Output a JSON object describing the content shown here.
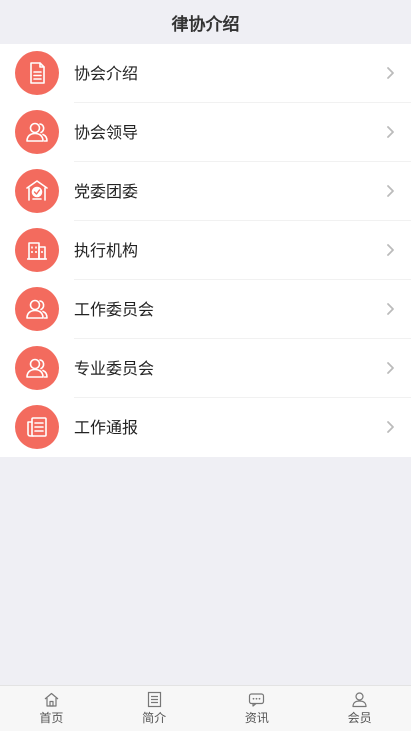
{
  "header": {
    "title": "律协介绍"
  },
  "menu": [
    {
      "label": "协会介绍",
      "icon": "document-icon"
    },
    {
      "label": "协会领导",
      "icon": "users-icon"
    },
    {
      "label": "党委团委",
      "icon": "party-emblem-icon"
    },
    {
      "label": "执行机构",
      "icon": "building-icon"
    },
    {
      "label": "工作委员会",
      "icon": "users-icon"
    },
    {
      "label": "专业委员会",
      "icon": "users-icon"
    },
    {
      "label": "工作通报",
      "icon": "newspaper-icon"
    }
  ],
  "tabbar": [
    {
      "label": "首页",
      "icon": "home-icon"
    },
    {
      "label": "简介",
      "icon": "list-icon"
    },
    {
      "label": "资讯",
      "icon": "chat-icon"
    },
    {
      "label": "会员",
      "icon": "person-icon"
    }
  ],
  "colors": {
    "accent": "#f36b5e",
    "background": "#efeff4",
    "chevron": "#bbbbbb"
  }
}
